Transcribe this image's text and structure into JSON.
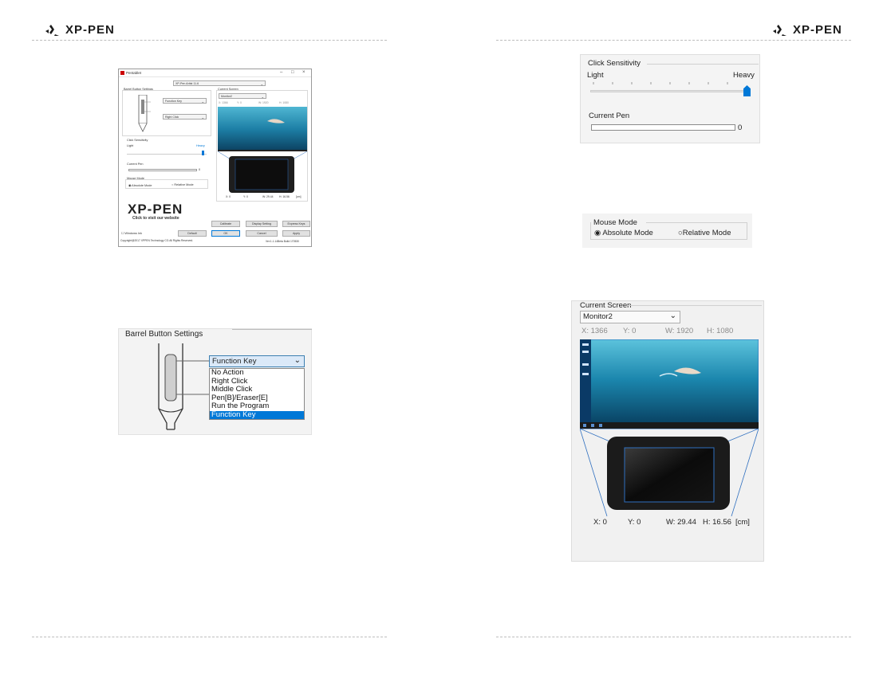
{
  "brand": {
    "logo_text": "XP-PEN"
  },
  "dialog": {
    "title": "Pentablet",
    "device": "XP-Pen Artist 11.6",
    "barrel_title": "Barrel Button Settings",
    "btn_upper": "Function Key",
    "btn_lower": "Right Click",
    "click_title": "Click Sensitivity",
    "light": "Light",
    "heavy": "Heavy",
    "current_pen": "Current Pen",
    "pen_value": "0",
    "mouse_title": "Mouse Mode",
    "absolute": "Absolute Mode",
    "relative": "Relative Mode",
    "screen_title": "Current Screen",
    "monitor": "Monitor2",
    "screen_coords": [
      "X: 1366",
      "Y: 0",
      "W: 1920",
      "H: 1080"
    ],
    "tablet_coords": [
      "X: 0",
      "Y: 0",
      "W: 29.44",
      "H: 16.56",
      "[cm]"
    ],
    "logo_caption": "Click to visit our website",
    "windows_ink": "Windows Ink",
    "buttons": {
      "calibrate": "Calibrate",
      "display_setting": "Display Setting",
      "express_keys": "Express Keys",
      "default": "Default",
      "ok": "OK",
      "cancel": "Cancel",
      "apply": "Apply"
    },
    "copyright": "Copyright@2017 XPPEN Technology CO.All Rights Reserved.",
    "version": "Ver:1.1.14Beta Build 170530"
  },
  "barrel_zoom": {
    "title": "Barrel Button Settings",
    "selected": "Function Key",
    "options": [
      "No Action",
      "Right Click",
      "Middle Click",
      "Pen[B]/Eraser[E]",
      "Run the Program",
      "Function Key"
    ],
    "highlighted_index": 5
  },
  "click_zoom": {
    "title": "Click Sensitivity",
    "light": "Light",
    "heavy": "Heavy",
    "slider_position": 1.0,
    "current_pen": "Current Pen",
    "pen_value": "0"
  },
  "mouse_zoom": {
    "title": "Mouse Mode",
    "absolute": "Absolute Mode",
    "relative": "Relative Mode",
    "selected": "absolute"
  },
  "screen_zoom": {
    "title": "Current Screen",
    "monitor": "Monitor2",
    "screen": {
      "x": "X: 1366",
      "y": "Y: 0",
      "w": "W: 1920",
      "h": "H: 1080"
    },
    "tablet": {
      "x": "X: 0",
      "y": "Y: 0",
      "w": "W: 29.44",
      "h": "H: 16.56",
      "unit": "[cm]"
    }
  }
}
